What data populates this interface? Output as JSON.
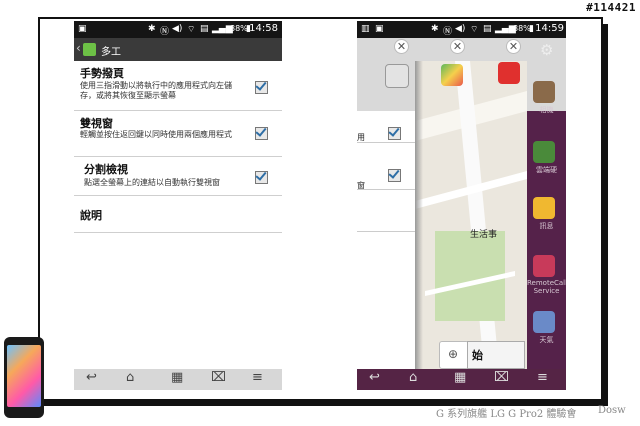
{
  "watermark": {
    "post_id": "#114421",
    "caption": "G 系列旗艦 LG G Pro2 體驗會",
    "author": "Dosw"
  },
  "left_phone": {
    "status": {
      "time": "14:58",
      "battery": "88%"
    },
    "title": "多工",
    "settings": [
      {
        "title": "手勢撥頁",
        "desc": "使用三指滑動以將執行中的應用程式向左儲存，或將其恢復至顯示螢幕",
        "checked": true
      },
      {
        "title": "雙視窗",
        "desc": "輕觸並按住返回鍵以同時使用兩個應用程式",
        "checked": true
      },
      {
        "title": "分割檢視",
        "desc": "點選全螢幕上的連結以自動執行雙視窗",
        "checked": true
      },
      {
        "title": "說明",
        "desc": ""
      }
    ]
  },
  "right_phone": {
    "status": {
      "time": "14:59",
      "battery": "88%"
    },
    "peek_texts": {
      "row1": "用",
      "row2": "窗"
    },
    "map_label": "生活事",
    "start_button": "始",
    "side_apps": [
      "相機",
      "雲端硬",
      "訊息",
      "RemoteCall Service",
      "天氣"
    ]
  },
  "colors": {
    "right_accent": "#552445",
    "checkbox_blue": "#2e6ea6"
  }
}
